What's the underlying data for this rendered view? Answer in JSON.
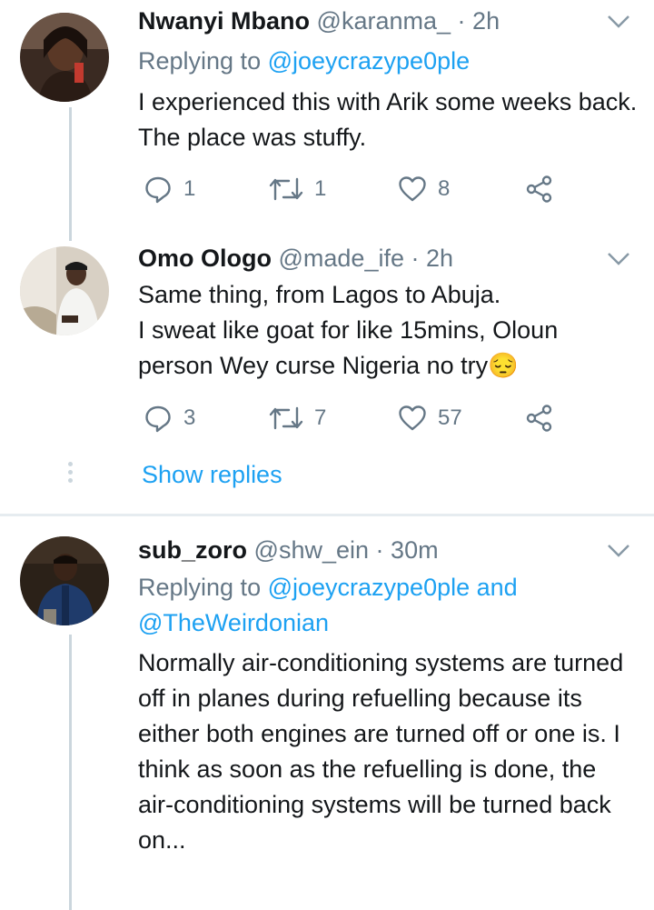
{
  "tweets": [
    {
      "name": "Nwanyi Mbano",
      "handle": "@karanma_",
      "dot": "·",
      "time": "2h",
      "replying_prefix": "Replying to ",
      "replying_to": "@joeycrazype0ple",
      "text": "I experienced this with Arik some weeks back. The place was stuffy.",
      "replies": "1",
      "retweets": "1",
      "likes": "8"
    },
    {
      "name": "Omo Ologo",
      "handle": "@made_ife",
      "dot": "·",
      "time": "2h",
      "text_line1": "Same thing, from Lagos to Abuja.",
      "text_line2": "I sweat like goat for like 15mins, Oloun",
      "text_line3": "person Wey curse Nigeria no try",
      "emoji": "😔",
      "replies": "3",
      "retweets": "7",
      "likes": "57",
      "show_replies": "Show replies"
    },
    {
      "name": "sub_zoro",
      "handle": "@shw_ein",
      "dot": "·",
      "time": "30m",
      "replying_prefix": "Replying to ",
      "replying_to": "@joeycrazype0ple",
      "replying_and": " and",
      "replying_to_2": "@TheWeirdonian",
      "text": "Normally air-conditioning systems are turned off in planes during refuelling because its either both engines are turned off or one is. I think as soon as the refuelling is done, the air-conditioning systems will be turned back on..."
    }
  ],
  "colors": {
    "accent": "#1da1f2",
    "secondary_text": "#657786",
    "primary_text": "#14171a",
    "thread_line": "#cbd6dd",
    "divider": "#e6ecf0"
  },
  "icons": [
    "reply-icon",
    "retweet-icon",
    "like-icon",
    "share-icon",
    "chevron-down-icon",
    "avatar"
  ]
}
